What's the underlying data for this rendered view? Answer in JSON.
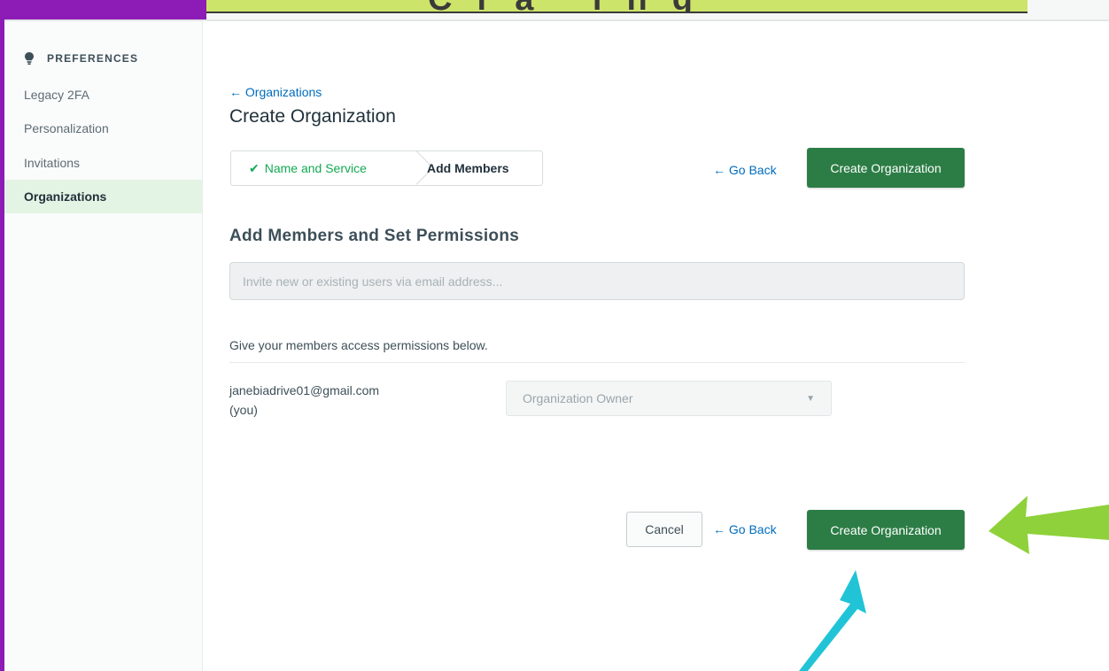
{
  "banner": {
    "text": "Cra ing"
  },
  "sidebar": {
    "header": "PREFERENCES",
    "header_icon": "lightbulb-icon",
    "items": [
      {
        "label": "Legacy 2FA"
      },
      {
        "label": "Personalization"
      },
      {
        "label": "Invitations"
      },
      {
        "label": "Organizations",
        "active": true
      }
    ]
  },
  "main": {
    "back_link": "← Organizations",
    "title": "Create Organization",
    "stepper": {
      "step1": "Name and Service",
      "step1_icon": "checkmark-icon",
      "step2": "Add Members"
    },
    "go_back": "← Go Back",
    "create_button": "Create Organization",
    "section_title": "Add Members and Set Permissions",
    "invite_placeholder": "Invite new or existing users via email address...",
    "permissions_text": "Give your members access permissions below.",
    "member": {
      "email": "janebiadrive01@gmail.com",
      "you_label": "(you)",
      "role": "Organization Owner"
    },
    "cancel_button": "Cancel"
  },
  "colors": {
    "primary_green": "#2c7d45",
    "link_blue": "#006cbc",
    "active_nav_bg": "#e4f4e4",
    "accent_purple": "#8d1bb5",
    "annotation_green_arrow": "#8ed13a",
    "annotation_cyan_arrow": "#20c4d6"
  }
}
